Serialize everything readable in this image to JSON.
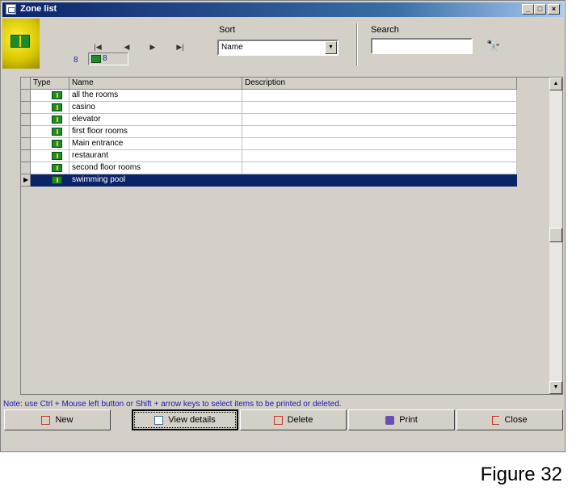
{
  "window": {
    "title": "Zone list"
  },
  "navigation": {
    "record_count": "8",
    "current_record": "8"
  },
  "sort": {
    "label": "Sort",
    "value": "Name"
  },
  "search": {
    "label": "Search",
    "value": ""
  },
  "grid": {
    "columns": [
      "Type",
      "Name",
      "Description"
    ],
    "rows": [
      {
        "name": "all the rooms",
        "description": "",
        "selected": false
      },
      {
        "name": "casino",
        "description": "",
        "selected": false
      },
      {
        "name": "elevator",
        "description": "",
        "selected": false
      },
      {
        "name": "first floor rooms",
        "description": "",
        "selected": false
      },
      {
        "name": "Main entrance",
        "description": "",
        "selected": false
      },
      {
        "name": "restaurant",
        "description": "",
        "selected": false
      },
      {
        "name": "second floor rooms",
        "description": "",
        "selected": false
      },
      {
        "name": "swimming pool",
        "description": "",
        "selected": true
      }
    ]
  },
  "note": "Note: use Ctrl + Mouse left button or Shift + arrow keys to select items to be printed or deleted.",
  "buttons": {
    "new": "New",
    "view_details": "View details",
    "delete": "Delete",
    "print": "Print",
    "close": "Close"
  },
  "figure_label": "Figure 32",
  "colors": {
    "selection": "#0a246a",
    "zone_icon": "#1f8a2a",
    "note_text": "#1a1aa8"
  }
}
